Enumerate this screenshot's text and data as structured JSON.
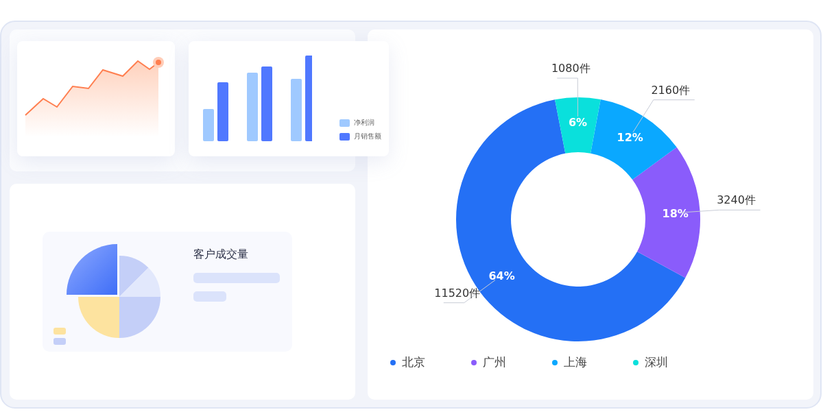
{
  "bar_card": {
    "legend": [
      {
        "label": "净利润",
        "color": "#9fc9ff"
      },
      {
        "label": "月销售额",
        "color": "#5078ff"
      }
    ]
  },
  "customer_card": {
    "title": "客户成交量"
  },
  "donut": {
    "chart_data": {
      "type": "donut",
      "categories": [
        "北京",
        "广州",
        "上海",
        "深圳"
      ],
      "values": [
        11520,
        3240,
        2160,
        1080
      ],
      "value_labels": [
        "11520件",
        "3240件",
        "2160件",
        "1080件"
      ],
      "annotations": [
        "64%",
        "18%",
        "12%",
        "6%"
      ]
    },
    "legend": [
      {
        "color": "#2470f5"
      },
      {
        "color": "#8a5cfb"
      },
      {
        "color": "#0aa8ff"
      },
      {
        "color": "#0ae0dc"
      }
    ]
  }
}
